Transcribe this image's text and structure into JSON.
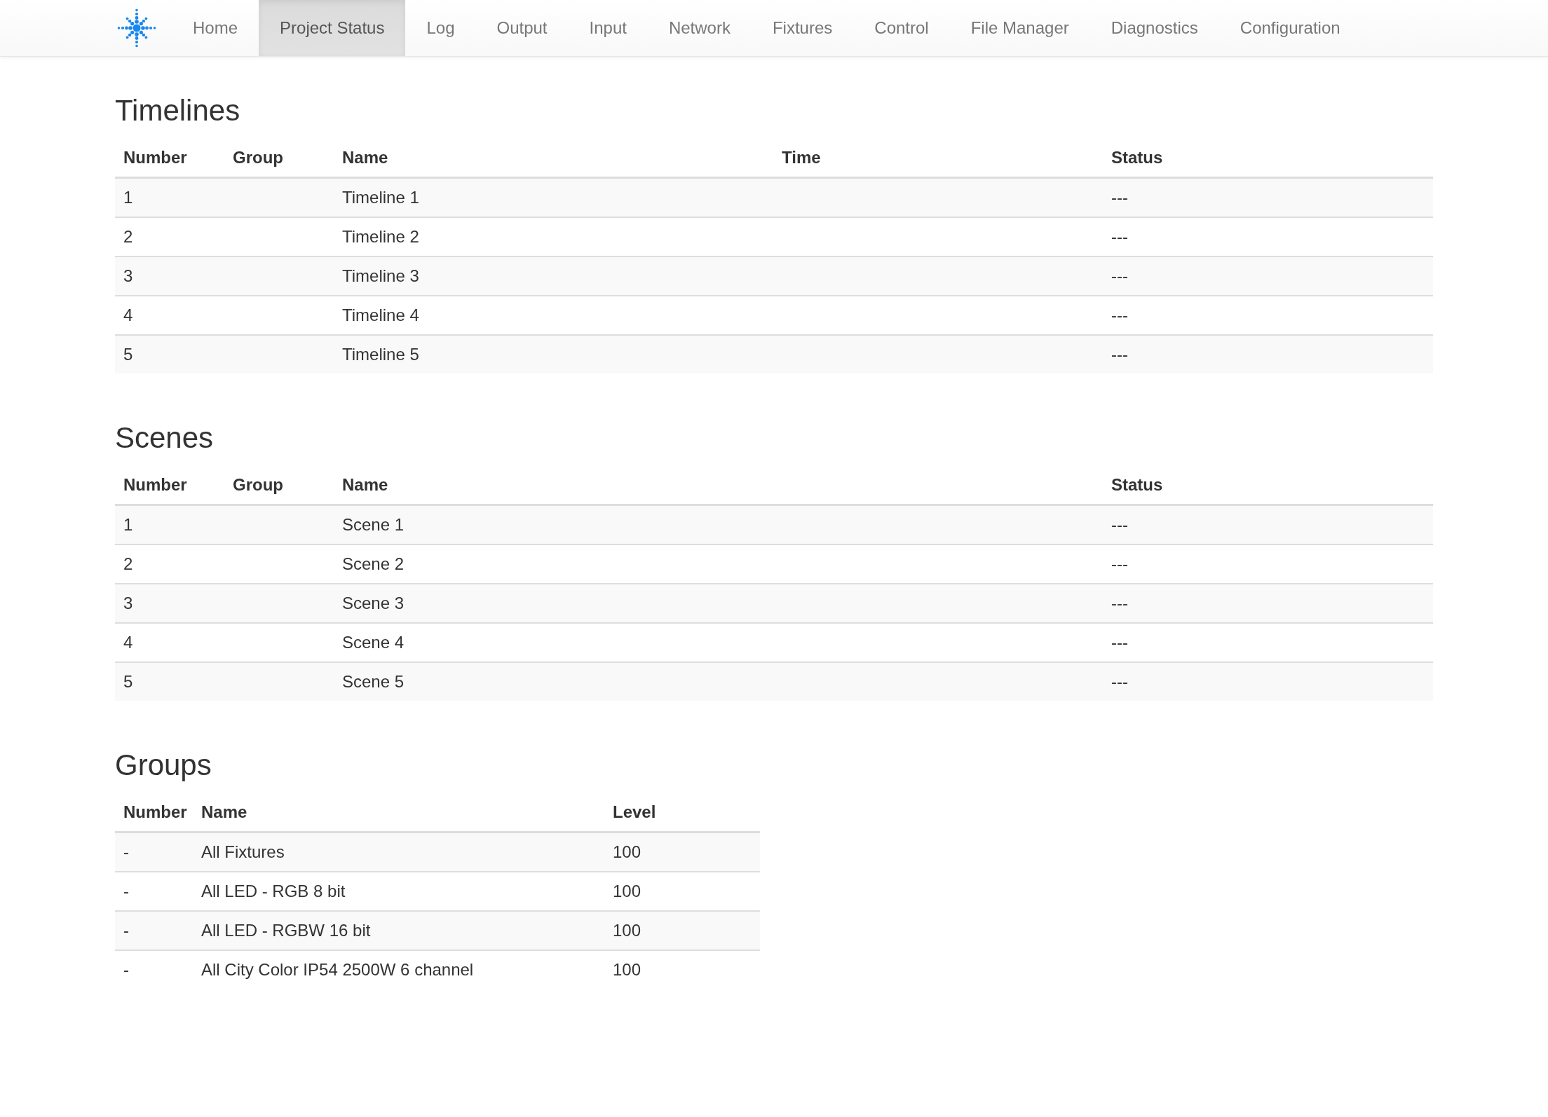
{
  "nav": {
    "items": [
      {
        "label": "Home",
        "selected": false
      },
      {
        "label": "Project Status",
        "selected": true
      },
      {
        "label": "Log",
        "selected": false
      },
      {
        "label": "Output",
        "selected": false
      },
      {
        "label": "Input",
        "selected": false
      },
      {
        "label": "Network",
        "selected": false
      },
      {
        "label": "Fixtures",
        "selected": false
      },
      {
        "label": "Control",
        "selected": false
      },
      {
        "label": "File Manager",
        "selected": false
      },
      {
        "label": "Diagnostics",
        "selected": false
      },
      {
        "label": "Configuration",
        "selected": false
      }
    ]
  },
  "sections": [
    {
      "kind": "timelines",
      "title": "Timelines",
      "columns": [
        "Number",
        "Group",
        "Name",
        "Time",
        "Status"
      ],
      "rows": [
        {
          "number": "1",
          "name": "Timeline 1",
          "status": "---"
        },
        {
          "number": "2",
          "name": "Timeline 2",
          "status": "---"
        },
        {
          "number": "3",
          "name": "Timeline 3",
          "status": "---"
        },
        {
          "number": "4",
          "name": "Timeline 4",
          "status": "---"
        },
        {
          "number": "5",
          "name": "Timeline 5",
          "status": "---"
        }
      ]
    },
    {
      "kind": "scenes",
      "title": "Scenes",
      "columns": [
        "Number",
        "Group",
        "Name",
        "Status"
      ],
      "rows": [
        {
          "number": "1",
          "name": "Scene 1",
          "status": "---"
        },
        {
          "number": "2",
          "name": "Scene 2",
          "status": "---"
        },
        {
          "number": "3",
          "name": "Scene 3",
          "status": "---"
        },
        {
          "number": "4",
          "name": "Scene 4",
          "status": "---"
        },
        {
          "number": "5",
          "name": "Scene 5",
          "status": "---"
        }
      ]
    },
    {
      "kind": "groups",
      "title": "Groups",
      "columns": [
        "Number",
        "Name",
        "Level"
      ],
      "rows": [
        {
          "number": "-",
          "name": "All Fixtures",
          "level_value": "100"
        },
        {
          "number": "-",
          "name": "All LED - RGB 8 bit",
          "level_value": "100"
        },
        {
          "number": "-",
          "name": "All LED - RGBW 16 bit",
          "level_value": "100"
        },
        {
          "number": "-",
          "name": "All City Color IP54 2500W 6 channel",
          "level_value": "100"
        }
      ]
    }
  ]
}
